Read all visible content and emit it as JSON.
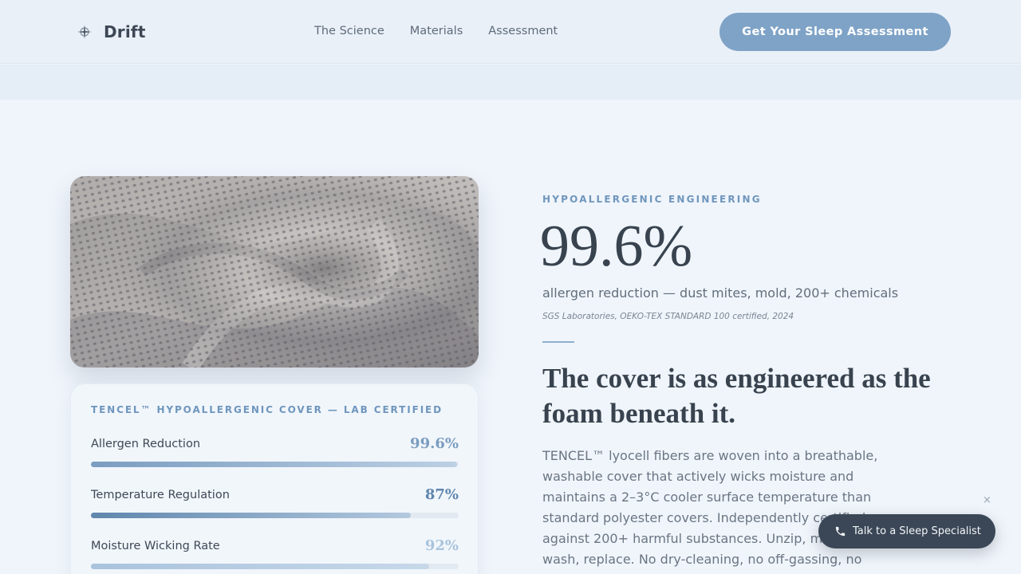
{
  "nav": {
    "brand": "Drift",
    "links": [
      "The Science",
      "Materials",
      "Assessment"
    ],
    "cta": "Get Your Sleep Assessment"
  },
  "card": {
    "title": "TENCEL™ HYPOALLERGENIC COVER — LAB CERTIFIED",
    "metrics": [
      {
        "label": "Allergen Reduction",
        "value": "99.6%",
        "fill_fraction": 0.996
      },
      {
        "label": "Temperature Regulation",
        "value": "87%",
        "fill_fraction": 0.87
      },
      {
        "label": "Moisture Wicking Rate",
        "value": "92%",
        "fill_fraction": 0.92
      }
    ]
  },
  "hero": {
    "eyebrow": "HYPOALLERGENIC ENGINEERING",
    "stat": "99.6%",
    "stat_desc": "allergen reduction — dust mites, mold, 200+ chemicals",
    "stat_source": "SGS Laboratories, OEKO-TEX STANDARD 100 certified, 2024",
    "headline": "The cover is as engineered as the foam beneath it.",
    "body": "TENCEL™ lyocell fibers are woven into a breathable, washable cover that actively wicks moisture and maintains a 2–3°C cooler surface temperature than standard polyester covers. Independently certified against 200+ harmful substances. Unzip, machine wash, replace. No dry-cleaning, no off-gassing, no"
  },
  "chat": {
    "label": "Talk to a Sleep Specialist",
    "close": "×"
  },
  "colors": {
    "accent": "#7fa3c7",
    "eyebrow": "#6f96bd",
    "dark": "#3b4756",
    "background": "#f0f5fb"
  },
  "icons": {
    "brand": "brand-star-icon",
    "chat": "phone-icon",
    "close": "close-icon"
  }
}
